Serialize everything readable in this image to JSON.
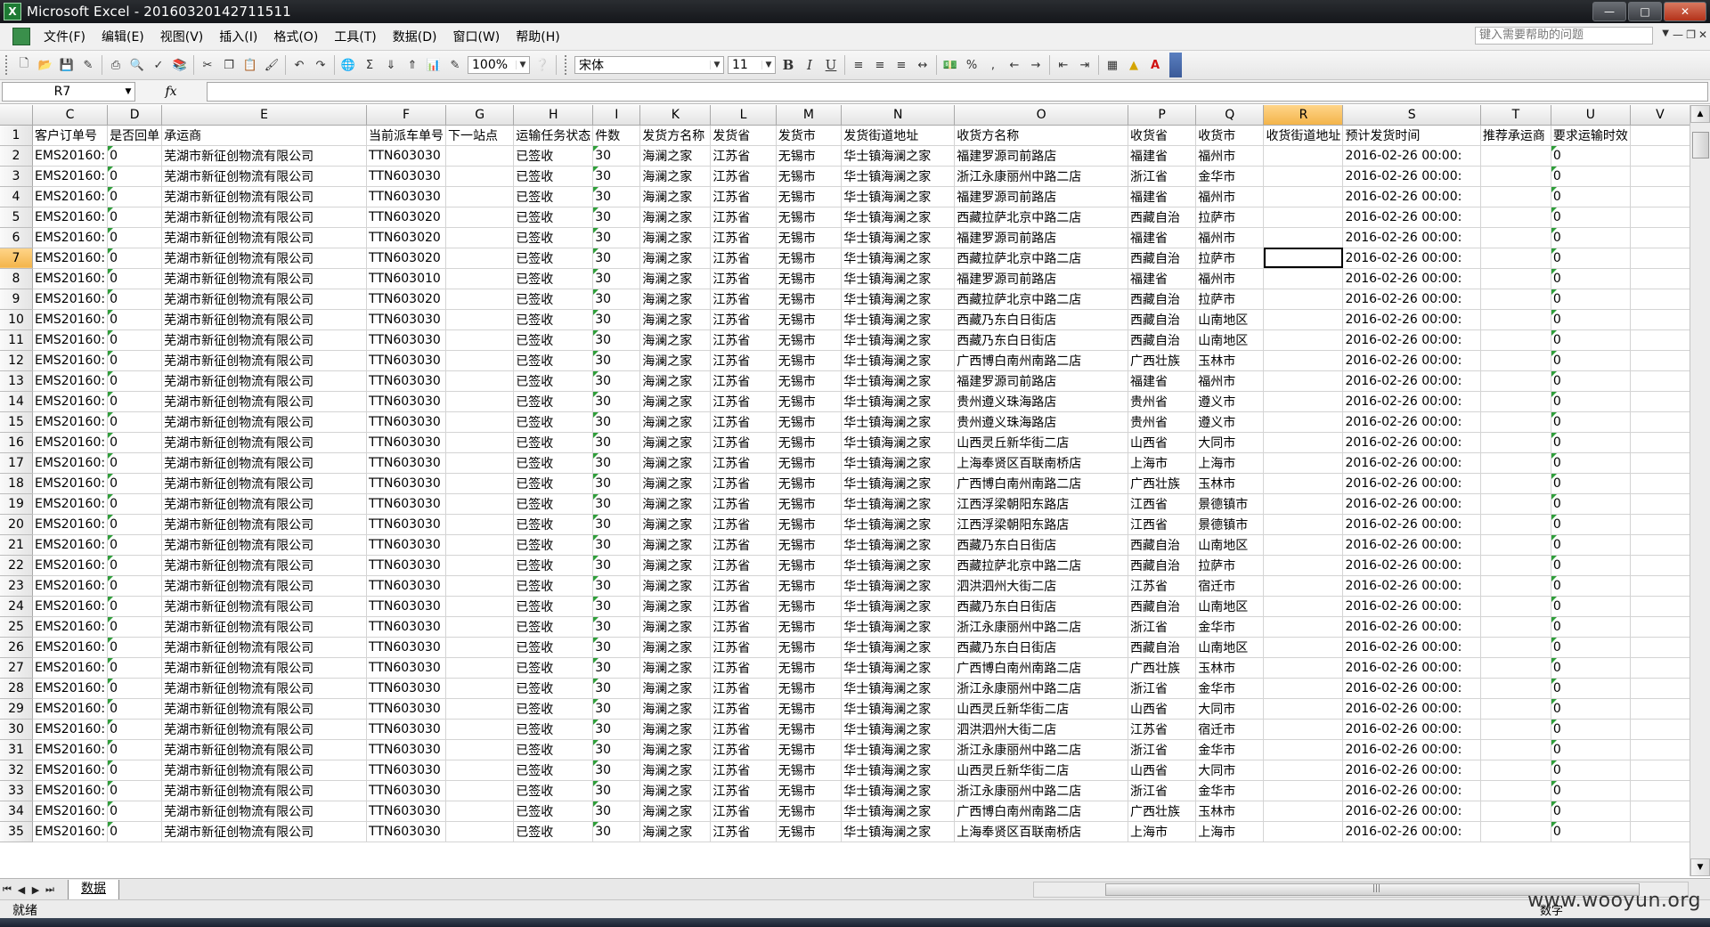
{
  "window": {
    "title": "Microsoft Excel - 20160320142711511",
    "app_icon": "excel-icon",
    "controls": [
      "minimize",
      "maximize",
      "close"
    ]
  },
  "menu": {
    "items": [
      "文件(F)",
      "编辑(E)",
      "视图(V)",
      "插入(I)",
      "格式(O)",
      "工具(T)",
      "数据(D)",
      "窗口(W)",
      "帮助(H)"
    ],
    "help_placeholder": "键入需要帮助的问题"
  },
  "toolbar": {
    "zoom": "100%",
    "font": "宋体",
    "font_size": "11",
    "bold": "B",
    "italic": "I",
    "underline": "U",
    "percent": "%",
    "sum": "Σ"
  },
  "formula_bar": {
    "name_box": "R7",
    "fx": "fx",
    "formula": ""
  },
  "sheet": {
    "columns": [
      "C",
      "D",
      "E",
      "F",
      "G",
      "H",
      "I",
      "K",
      "L",
      "M",
      "N",
      "O",
      "P",
      "Q",
      "R",
      "S",
      "T",
      "U",
      "V"
    ],
    "active_col": "R",
    "active_row": "7",
    "header_row": [
      "客户订单号",
      "是否回单",
      "承运商",
      "当前派车单号",
      "下一站点",
      "运输任务状态",
      "件数",
      "发货方名称",
      "发货省",
      "发货市",
      "发货街道地址",
      "收货方名称",
      "收货省",
      "收货市",
      "收货街道地址",
      "预计发货时间",
      "推荐承运商",
      "要求运输时效",
      ""
    ],
    "rows": [
      {
        "n": "2",
        "C": "EMS20160:",
        "D": "0",
        "E": "芜湖市新征创物流有限公司",
        "F": "TTN603030",
        "H": "已签收",
        "I": "30",
        "K": "海澜之家",
        "L": "江苏省",
        "M": "无锡市",
        "N": "华士镇海澜之家",
        "O": "福建罗源司前路店",
        "P": "福建省",
        "Q": "福州市",
        "S": "2016-02-26 00:00:",
        "U": "0"
      },
      {
        "n": "3",
        "C": "EMS20160:",
        "D": "0",
        "E": "芜湖市新征创物流有限公司",
        "F": "TTN603030",
        "H": "已签收",
        "I": "30",
        "K": "海澜之家",
        "L": "江苏省",
        "M": "无锡市",
        "N": "华士镇海澜之家",
        "O": "浙江永康丽州中路二店",
        "P": "浙江省",
        "Q": "金华市",
        "S": "2016-02-26 00:00:",
        "U": "0"
      },
      {
        "n": "4",
        "C": "EMS20160:",
        "D": "0",
        "E": "芜湖市新征创物流有限公司",
        "F": "TTN603030",
        "H": "已签收",
        "I": "30",
        "K": "海澜之家",
        "L": "江苏省",
        "M": "无锡市",
        "N": "华士镇海澜之家",
        "O": "福建罗源司前路店",
        "P": "福建省",
        "Q": "福州市",
        "S": "2016-02-26 00:00:",
        "U": "0"
      },
      {
        "n": "5",
        "C": "EMS20160:",
        "D": "0",
        "E": "芜湖市新征创物流有限公司",
        "F": "TTN603020",
        "H": "已签收",
        "I": "30",
        "K": "海澜之家",
        "L": "江苏省",
        "M": "无锡市",
        "N": "华士镇海澜之家",
        "O": "西藏拉萨北京中路二店",
        "P": "西藏自治",
        "Q": "拉萨市",
        "S": "2016-02-26 00:00:",
        "U": "0"
      },
      {
        "n": "6",
        "C": "EMS20160:",
        "D": "0",
        "E": "芜湖市新征创物流有限公司",
        "F": "TTN603020",
        "H": "已签收",
        "I": "30",
        "K": "海澜之家",
        "L": "江苏省",
        "M": "无锡市",
        "N": "华士镇海澜之家",
        "O": "福建罗源司前路店",
        "P": "福建省",
        "Q": "福州市",
        "S": "2016-02-26 00:00:",
        "U": "0"
      },
      {
        "n": "7",
        "C": "EMS20160:",
        "D": "0",
        "E": "芜湖市新征创物流有限公司",
        "F": "TTN603020",
        "H": "已签收",
        "I": "30",
        "K": "海澜之家",
        "L": "江苏省",
        "M": "无锡市",
        "N": "华士镇海澜之家",
        "O": "西藏拉萨北京中路二店",
        "P": "西藏自治",
        "Q": "拉萨市",
        "S": "2016-02-26 00:00:",
        "U": "0"
      },
      {
        "n": "8",
        "C": "EMS20160:",
        "D": "0",
        "E": "芜湖市新征创物流有限公司",
        "F": "TTN603010",
        "H": "已签收",
        "I": "30",
        "K": "海澜之家",
        "L": "江苏省",
        "M": "无锡市",
        "N": "华士镇海澜之家",
        "O": "福建罗源司前路店",
        "P": "福建省",
        "Q": "福州市",
        "S": "2016-02-26 00:00:",
        "U": "0"
      },
      {
        "n": "9",
        "C": "EMS20160:",
        "D": "0",
        "E": "芜湖市新征创物流有限公司",
        "F": "TTN603020",
        "H": "已签收",
        "I": "30",
        "K": "海澜之家",
        "L": "江苏省",
        "M": "无锡市",
        "N": "华士镇海澜之家",
        "O": "西藏拉萨北京中路二店",
        "P": "西藏自治",
        "Q": "拉萨市",
        "S": "2016-02-26 00:00:",
        "U": "0"
      },
      {
        "n": "10",
        "C": "EMS20160:",
        "D": "0",
        "E": "芜湖市新征创物流有限公司",
        "F": "TTN603030",
        "H": "已签收",
        "I": "30",
        "K": "海澜之家",
        "L": "江苏省",
        "M": "无锡市",
        "N": "华士镇海澜之家",
        "O": "西藏乃东白日街店",
        "P": "西藏自治",
        "Q": "山南地区",
        "S": "2016-02-26 00:00:",
        "U": "0"
      },
      {
        "n": "11",
        "C": "EMS20160:",
        "D": "0",
        "E": "芜湖市新征创物流有限公司",
        "F": "TTN603030",
        "H": "已签收",
        "I": "30",
        "K": "海澜之家",
        "L": "江苏省",
        "M": "无锡市",
        "N": "华士镇海澜之家",
        "O": "西藏乃东白日街店",
        "P": "西藏自治",
        "Q": "山南地区",
        "S": "2016-02-26 00:00:",
        "U": "0"
      },
      {
        "n": "12",
        "C": "EMS20160:",
        "D": "0",
        "E": "芜湖市新征创物流有限公司",
        "F": "TTN603030",
        "H": "已签收",
        "I": "30",
        "K": "海澜之家",
        "L": "江苏省",
        "M": "无锡市",
        "N": "华士镇海澜之家",
        "O": "广西博白南州南路二店",
        "P": "广西壮族",
        "Q": "玉林市",
        "S": "2016-02-26 00:00:",
        "U": "0"
      },
      {
        "n": "13",
        "C": "EMS20160:",
        "D": "0",
        "E": "芜湖市新征创物流有限公司",
        "F": "TTN603030",
        "H": "已签收",
        "I": "30",
        "K": "海澜之家",
        "L": "江苏省",
        "M": "无锡市",
        "N": "华士镇海澜之家",
        "O": "福建罗源司前路店",
        "P": "福建省",
        "Q": "福州市",
        "S": "2016-02-26 00:00:",
        "U": "0"
      },
      {
        "n": "14",
        "C": "EMS20160:",
        "D": "0",
        "E": "芜湖市新征创物流有限公司",
        "F": "TTN603030",
        "H": "已签收",
        "I": "30",
        "K": "海澜之家",
        "L": "江苏省",
        "M": "无锡市",
        "N": "华士镇海澜之家",
        "O": "贵州遵义珠海路店",
        "P": "贵州省",
        "Q": "遵义市",
        "S": "2016-02-26 00:00:",
        "U": "0"
      },
      {
        "n": "15",
        "C": "EMS20160:",
        "D": "0",
        "E": "芜湖市新征创物流有限公司",
        "F": "TTN603030",
        "H": "已签收",
        "I": "30",
        "K": "海澜之家",
        "L": "江苏省",
        "M": "无锡市",
        "N": "华士镇海澜之家",
        "O": "贵州遵义珠海路店",
        "P": "贵州省",
        "Q": "遵义市",
        "S": "2016-02-26 00:00:",
        "U": "0"
      },
      {
        "n": "16",
        "C": "EMS20160:",
        "D": "0",
        "E": "芜湖市新征创物流有限公司",
        "F": "TTN603030",
        "H": "已签收",
        "I": "30",
        "K": "海澜之家",
        "L": "江苏省",
        "M": "无锡市",
        "N": "华士镇海澜之家",
        "O": "山西灵丘新华街二店",
        "P": "山西省",
        "Q": "大同市",
        "S": "2016-02-26 00:00:",
        "U": "0"
      },
      {
        "n": "17",
        "C": "EMS20160:",
        "D": "0",
        "E": "芜湖市新征创物流有限公司",
        "F": "TTN603030",
        "H": "已签收",
        "I": "30",
        "K": "海澜之家",
        "L": "江苏省",
        "M": "无锡市",
        "N": "华士镇海澜之家",
        "O": "上海奉贤区百联南桥店",
        "P": "上海市",
        "Q": "上海市",
        "S": "2016-02-26 00:00:",
        "U": "0"
      },
      {
        "n": "18",
        "C": "EMS20160:",
        "D": "0",
        "E": "芜湖市新征创物流有限公司",
        "F": "TTN603030",
        "H": "已签收",
        "I": "30",
        "K": "海澜之家",
        "L": "江苏省",
        "M": "无锡市",
        "N": "华士镇海澜之家",
        "O": "广西博白南州南路二店",
        "P": "广西壮族",
        "Q": "玉林市",
        "S": "2016-02-26 00:00:",
        "U": "0"
      },
      {
        "n": "19",
        "C": "EMS20160:",
        "D": "0",
        "E": "芜湖市新征创物流有限公司",
        "F": "TTN603030",
        "H": "已签收",
        "I": "30",
        "K": "海澜之家",
        "L": "江苏省",
        "M": "无锡市",
        "N": "华士镇海澜之家",
        "O": "江西浮梁朝阳东路店",
        "P": "江西省",
        "Q": "景德镇市",
        "S": "2016-02-26 00:00:",
        "U": "0"
      },
      {
        "n": "20",
        "C": "EMS20160:",
        "D": "0",
        "E": "芜湖市新征创物流有限公司",
        "F": "TTN603030",
        "H": "已签收",
        "I": "30",
        "K": "海澜之家",
        "L": "江苏省",
        "M": "无锡市",
        "N": "华士镇海澜之家",
        "O": "江西浮梁朝阳东路店",
        "P": "江西省",
        "Q": "景德镇市",
        "S": "2016-02-26 00:00:",
        "U": "0"
      },
      {
        "n": "21",
        "C": "EMS20160:",
        "D": "0",
        "E": "芜湖市新征创物流有限公司",
        "F": "TTN603030",
        "H": "已签收",
        "I": "30",
        "K": "海澜之家",
        "L": "江苏省",
        "M": "无锡市",
        "N": "华士镇海澜之家",
        "O": "西藏乃东白日街店",
        "P": "西藏自治",
        "Q": "山南地区",
        "S": "2016-02-26 00:00:",
        "U": "0"
      },
      {
        "n": "22",
        "C": "EMS20160:",
        "D": "0",
        "E": "芜湖市新征创物流有限公司",
        "F": "TTN603030",
        "H": "已签收",
        "I": "30",
        "K": "海澜之家",
        "L": "江苏省",
        "M": "无锡市",
        "N": "华士镇海澜之家",
        "O": "西藏拉萨北京中路二店",
        "P": "西藏自治",
        "Q": "拉萨市",
        "S": "2016-02-26 00:00:",
        "U": "0"
      },
      {
        "n": "23",
        "C": "EMS20160:",
        "D": "0",
        "E": "芜湖市新征创物流有限公司",
        "F": "TTN603030",
        "H": "已签收",
        "I": "30",
        "K": "海澜之家",
        "L": "江苏省",
        "M": "无锡市",
        "N": "华士镇海澜之家",
        "O": "泗洪泗州大街二店",
        "P": "江苏省",
        "Q": "宿迁市",
        "S": "2016-02-26 00:00:",
        "U": "0"
      },
      {
        "n": "24",
        "C": "EMS20160:",
        "D": "0",
        "E": "芜湖市新征创物流有限公司",
        "F": "TTN603030",
        "H": "已签收",
        "I": "30",
        "K": "海澜之家",
        "L": "江苏省",
        "M": "无锡市",
        "N": "华士镇海澜之家",
        "O": "西藏乃东白日街店",
        "P": "西藏自治",
        "Q": "山南地区",
        "S": "2016-02-26 00:00:",
        "U": "0"
      },
      {
        "n": "25",
        "C": "EMS20160:",
        "D": "0",
        "E": "芜湖市新征创物流有限公司",
        "F": "TTN603030",
        "H": "已签收",
        "I": "30",
        "K": "海澜之家",
        "L": "江苏省",
        "M": "无锡市",
        "N": "华士镇海澜之家",
        "O": "浙江永康丽州中路二店",
        "P": "浙江省",
        "Q": "金华市",
        "S": "2016-02-26 00:00:",
        "U": "0"
      },
      {
        "n": "26",
        "C": "EMS20160:",
        "D": "0",
        "E": "芜湖市新征创物流有限公司",
        "F": "TTN603030",
        "H": "已签收",
        "I": "30",
        "K": "海澜之家",
        "L": "江苏省",
        "M": "无锡市",
        "N": "华士镇海澜之家",
        "O": "西藏乃东白日街店",
        "P": "西藏自治",
        "Q": "山南地区",
        "S": "2016-02-26 00:00:",
        "U": "0"
      },
      {
        "n": "27",
        "C": "EMS20160:",
        "D": "0",
        "E": "芜湖市新征创物流有限公司",
        "F": "TTN603030",
        "H": "已签收",
        "I": "30",
        "K": "海澜之家",
        "L": "江苏省",
        "M": "无锡市",
        "N": "华士镇海澜之家",
        "O": "广西博白南州南路二店",
        "P": "广西壮族",
        "Q": "玉林市",
        "S": "2016-02-26 00:00:",
        "U": "0"
      },
      {
        "n": "28",
        "C": "EMS20160:",
        "D": "0",
        "E": "芜湖市新征创物流有限公司",
        "F": "TTN603030",
        "H": "已签收",
        "I": "30",
        "K": "海澜之家",
        "L": "江苏省",
        "M": "无锡市",
        "N": "华士镇海澜之家",
        "O": "浙江永康丽州中路二店",
        "P": "浙江省",
        "Q": "金华市",
        "S": "2016-02-26 00:00:",
        "U": "0"
      },
      {
        "n": "29",
        "C": "EMS20160:",
        "D": "0",
        "E": "芜湖市新征创物流有限公司",
        "F": "TTN603030",
        "H": "已签收",
        "I": "30",
        "K": "海澜之家",
        "L": "江苏省",
        "M": "无锡市",
        "N": "华士镇海澜之家",
        "O": "山西灵丘新华街二店",
        "P": "山西省",
        "Q": "大同市",
        "S": "2016-02-26 00:00:",
        "U": "0"
      },
      {
        "n": "30",
        "C": "EMS20160:",
        "D": "0",
        "E": "芜湖市新征创物流有限公司",
        "F": "TTN603030",
        "H": "已签收",
        "I": "30",
        "K": "海澜之家",
        "L": "江苏省",
        "M": "无锡市",
        "N": "华士镇海澜之家",
        "O": "泗洪泗州大街二店",
        "P": "江苏省",
        "Q": "宿迁市",
        "S": "2016-02-26 00:00:",
        "U": "0"
      },
      {
        "n": "31",
        "C": "EMS20160:",
        "D": "0",
        "E": "芜湖市新征创物流有限公司",
        "F": "TTN603030",
        "H": "已签收",
        "I": "30",
        "K": "海澜之家",
        "L": "江苏省",
        "M": "无锡市",
        "N": "华士镇海澜之家",
        "O": "浙江永康丽州中路二店",
        "P": "浙江省",
        "Q": "金华市",
        "S": "2016-02-26 00:00:",
        "U": "0"
      },
      {
        "n": "32",
        "C": "EMS20160:",
        "D": "0",
        "E": "芜湖市新征创物流有限公司",
        "F": "TTN603030",
        "H": "已签收",
        "I": "30",
        "K": "海澜之家",
        "L": "江苏省",
        "M": "无锡市",
        "N": "华士镇海澜之家",
        "O": "山西灵丘新华街二店",
        "P": "山西省",
        "Q": "大同市",
        "S": "2016-02-26 00:00:",
        "U": "0"
      },
      {
        "n": "33",
        "C": "EMS20160:",
        "D": "0",
        "E": "芜湖市新征创物流有限公司",
        "F": "TTN603030",
        "H": "已签收",
        "I": "30",
        "K": "海澜之家",
        "L": "江苏省",
        "M": "无锡市",
        "N": "华士镇海澜之家",
        "O": "浙江永康丽州中路二店",
        "P": "浙江省",
        "Q": "金华市",
        "S": "2016-02-26 00:00:",
        "U": "0"
      },
      {
        "n": "34",
        "C": "EMS20160:",
        "D": "0",
        "E": "芜湖市新征创物流有限公司",
        "F": "TTN603030",
        "H": "已签收",
        "I": "30",
        "K": "海澜之家",
        "L": "江苏省",
        "M": "无锡市",
        "N": "华士镇海澜之家",
        "O": "广西博白南州南路二店",
        "P": "广西壮族",
        "Q": "玉林市",
        "S": "2016-02-26 00:00:",
        "U": "0"
      },
      {
        "n": "35",
        "C": "EMS20160:",
        "D": "0",
        "E": "芜湖市新征创物流有限公司",
        "F": "TTN603030",
        "H": "已签收",
        "I": "30",
        "K": "海澜之家",
        "L": "江苏省",
        "M": "无锡市",
        "N": "华士镇海澜之家",
        "O": "上海奉贤区百联南桥店",
        "P": "上海市",
        "Q": "上海市",
        "S": "2016-02-26 00:00:",
        "U": "0"
      }
    ]
  },
  "sheet_tabs": [
    "数据"
  ],
  "status": {
    "text": "就绪",
    "mode": "数字",
    "watermark": "www.wooyun.org"
  },
  "colors": {
    "active_header": "#f3b44a",
    "error_flag": "#2f9e3a",
    "title_bar": "#14161a"
  }
}
